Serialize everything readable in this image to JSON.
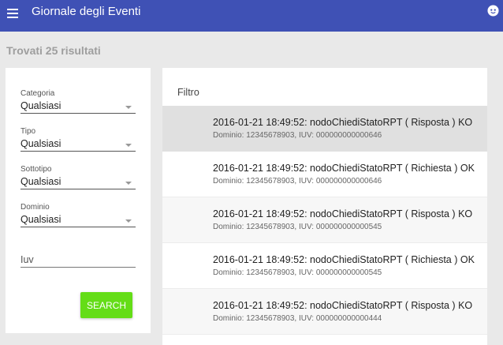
{
  "header": {
    "title": "Giornale degli Eventi",
    "menu_icon": "hamburger-menu-icon",
    "account_icon": "smiley-face-icon",
    "bar_color": "#3f51b5"
  },
  "results": {
    "text": "Trovati 25 risultati"
  },
  "filters": {
    "categoria": {
      "label": "Categoria",
      "value": "Qualsiasi"
    },
    "tipo": {
      "label": "Tipo",
      "value": "Qualsiasi"
    },
    "sottotipo": {
      "label": "Sottotipo",
      "value": "Qualsiasi"
    },
    "dominio": {
      "label": "Dominio",
      "value": "Qualsiasi"
    },
    "iuv": {
      "placeholder": "Iuv",
      "value": ""
    },
    "search_label": "SEARCH",
    "search_color": "#64dd17"
  },
  "list": {
    "header": "Filtro",
    "rows": [
      {
        "title": "2016-01-21 18:49:52: nodoChiediStatoRPT ( Risposta ) KO",
        "sub": "Dominio: 12345678903, IUV: 000000000000646"
      },
      {
        "title": "2016-01-21 18:49:52: nodoChiediStatoRPT ( Richiesta ) OK",
        "sub": "Dominio: 12345678903, IUV: 000000000000646"
      },
      {
        "title": "2016-01-21 18:49:52: nodoChiediStatoRPT ( Risposta ) KO",
        "sub": "Dominio: 12345678903, IUV: 000000000000545"
      },
      {
        "title": "2016-01-21 18:49:52: nodoChiediStatoRPT ( Richiesta ) OK",
        "sub": "Dominio: 12345678903, IUV: 000000000000545"
      },
      {
        "title": "2016-01-21 18:49:52: nodoChiediStatoRPT ( Risposta ) KO",
        "sub": "Dominio: 12345678903, IUV: 000000000000444"
      }
    ]
  }
}
